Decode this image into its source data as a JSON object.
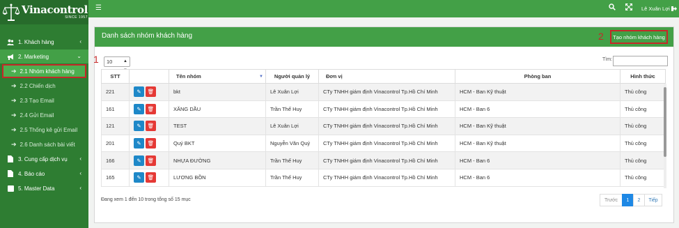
{
  "brand": {
    "name": "Vinacontrol",
    "since": "SINCE 1957"
  },
  "sidebar": {
    "items": [
      {
        "label": "1. Khách hàng",
        "icon": "users-icon"
      },
      {
        "label": "2. Marketing",
        "icon": "bullhorn-icon"
      },
      {
        "label": "3. Cung cấp dịch vụ",
        "icon": "file-icon"
      },
      {
        "label": "4. Báo cáo",
        "icon": "chart-icon"
      },
      {
        "label": "5. Master Data",
        "icon": "database-icon"
      }
    ],
    "marketing_sub": [
      "2.1 Nhóm khách hàng",
      "2.2 Chiến dịch",
      "2.3 Tạo Email",
      "2.4 Gửi Email",
      "2.5 Thống kê gửi Email",
      "2.6 Danh sách bài viết"
    ]
  },
  "topbar": {
    "user": "Lê Xuân Lợi"
  },
  "panel": {
    "title": "Danh sách nhóm khách hàng",
    "create_label": "Tạo nhóm khách hàng",
    "marker1": "1",
    "marker2": "2",
    "page_length": "10",
    "search_label": "Tìm:",
    "search_value": ""
  },
  "table": {
    "columns": [
      "STT",
      "",
      "Tên nhóm",
      "Người quản lý",
      "Đơn vị",
      "Phòng ban",
      "Hình thức"
    ],
    "rows": [
      {
        "stt": "221",
        "name": "bkt",
        "manager": "Lê Xuân Lợi",
        "unit": "CTy TNHH giám định Vinacontrol Tp.Hồ Chí Minh",
        "dept": "HCM - Ban Kỹ thuật",
        "type": "Thủ công"
      },
      {
        "stt": "161",
        "name": "XĂNG DẦU",
        "manager": "Trần Thế Huy",
        "unit": "CTy TNHH giám định Vinacontrol Tp.Hồ Chí Minh",
        "dept": "HCM - Ban 6",
        "type": "Thủ công"
      },
      {
        "stt": "121",
        "name": "TEST",
        "manager": "Lê Xuân Lợi",
        "unit": "CTy TNHH giám định Vinacontrol Tp.Hồ Chí Minh",
        "dept": "HCM - Ban Kỹ thuật",
        "type": "Thủ công"
      },
      {
        "stt": "201",
        "name": "Quý BKT",
        "manager": "Nguyễn Văn Quý",
        "unit": "CTy TNHH giám định Vinacontrol Tp.Hồ Chí Minh",
        "dept": "HCM - Ban Kỹ thuật",
        "type": "Thủ công"
      },
      {
        "stt": "166",
        "name": "NHỰA ĐƯỜNG",
        "manager": "Trần Thế Huy",
        "unit": "CTy TNHH giám định Vinacontrol Tp.Hồ Chí Minh",
        "dept": "HCM - Ban 6",
        "type": "Thủ công"
      },
      {
        "stt": "165",
        "name": "LƯƠNG BỒN",
        "manager": "Trần Thế Huy",
        "unit": "CTy TNHH giám định Vinacontrol Tp.Hồ Chí Minh",
        "dept": "HCM - Ban 6",
        "type": "Thủ công"
      }
    ],
    "info": "Đang xem 1 đến 10 trong tổng số 15 mục"
  },
  "pagination": {
    "prev": "Trước",
    "pages": [
      "1",
      "2"
    ],
    "current": "1",
    "next": "Tiếp"
  },
  "colors": {
    "sidebar": "#2e7d32",
    "accent": "#43a047",
    "edit": "#1e88c8",
    "delete": "#e53935",
    "highlight": "#c62828"
  }
}
